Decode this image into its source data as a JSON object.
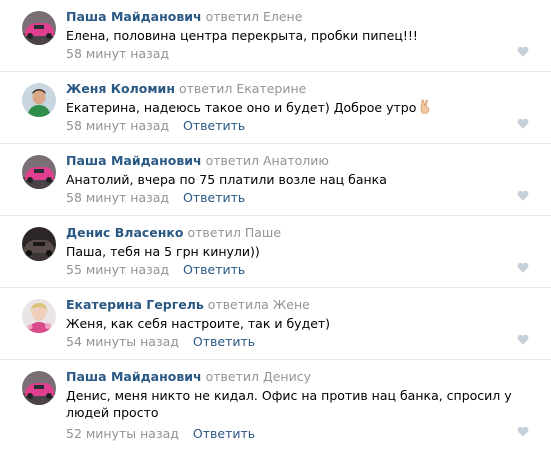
{
  "comments": [
    {
      "author": "Паша Майданович",
      "reply_word": "ответил",
      "reply_to": "Елене",
      "text": "Елена, половина центра перекрыта, пробки пипец!!!",
      "time": "58 минут назад",
      "reply_label": "",
      "avatar": "pink-car"
    },
    {
      "author": "Женя Коломин",
      "reply_word": "ответил",
      "reply_to": "Екатерине",
      "text": "Екатерина, надеюсь такое оно и будет) Доброе утро",
      "emoji": "victory-hand-emoji",
      "time": "58 минут назад",
      "reply_label": "Ответить",
      "avatar": "young-man"
    },
    {
      "author": "Паша Майданович",
      "reply_word": "ответил",
      "reply_to": "Анатолию",
      "text": "Анатолий, вчера по 75 платили возле нац банка",
      "time": "58 минут назад",
      "reply_label": "Ответить",
      "avatar": "pink-car"
    },
    {
      "author": "Денис Власенко",
      "reply_word": "ответил",
      "reply_to": "Паше",
      "text": "Паша, тебя на 5 грн кинули))",
      "time": "55 минут назад",
      "reply_label": "Ответить",
      "avatar": "dark-car"
    },
    {
      "author": "Екатерина Гергель",
      "reply_word": "ответила",
      "reply_to": "Жене",
      "text": "Женя, как себя настроите, так и будет)",
      "time": "54 минуты назад",
      "reply_label": "Ответить",
      "avatar": "woman-flowers"
    },
    {
      "author": "Паша Майданович",
      "reply_word": "ответил",
      "reply_to": "Денису",
      "text": "Денис, меня никто не кидал. Офис на против нац банка, спросил у людей просто",
      "time": "52 минуты назад",
      "reply_label": "Ответить",
      "avatar": "pink-car"
    }
  ],
  "colors": {
    "author": "#2a5885",
    "meta": "#939393",
    "divider": "#e7e8ec",
    "like": "#c5d0db"
  }
}
